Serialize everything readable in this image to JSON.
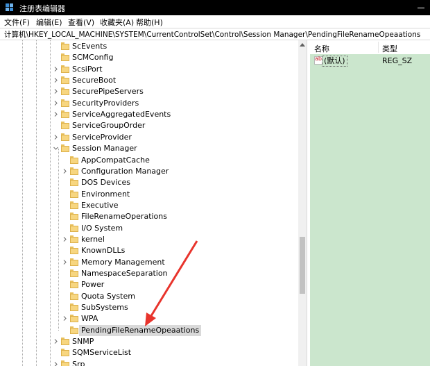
{
  "window": {
    "title": "注册表编辑器"
  },
  "menu": [
    "文件(F)",
    "编辑(E)",
    "查看(V)",
    "收藏夹(A)",
    "帮助(H)"
  ],
  "address": "计算机\\HKEY_LOCAL_MACHINE\\SYSTEM\\CurrentControlSet\\Control\\Session Manager\\PendingFileRenameOpeaations",
  "tree": {
    "items": [
      {
        "label": "ScEvents",
        "depth": 0,
        "expandable": false
      },
      {
        "label": "SCMConfig",
        "depth": 0,
        "expandable": false
      },
      {
        "label": "ScsiPort",
        "depth": 0,
        "expandable": true
      },
      {
        "label": "SecureBoot",
        "depth": 0,
        "expandable": true
      },
      {
        "label": "SecurePipeServers",
        "depth": 0,
        "expandable": true
      },
      {
        "label": "SecurityProviders",
        "depth": 0,
        "expandable": true
      },
      {
        "label": "ServiceAggregatedEvents",
        "depth": 0,
        "expandable": true
      },
      {
        "label": "ServiceGroupOrder",
        "depth": 0,
        "expandable": false
      },
      {
        "label": "ServiceProvider",
        "depth": 0,
        "expandable": true
      },
      {
        "label": "Session Manager",
        "depth": 0,
        "expandable": true,
        "expanded": true
      },
      {
        "label": "AppCompatCache",
        "depth": 1,
        "expandable": false
      },
      {
        "label": "Configuration Manager",
        "depth": 1,
        "expandable": true
      },
      {
        "label": "DOS Devices",
        "depth": 1,
        "expandable": false
      },
      {
        "label": "Environment",
        "depth": 1,
        "expandable": false
      },
      {
        "label": "Executive",
        "depth": 1,
        "expandable": false
      },
      {
        "label": "FileRenameOperations",
        "depth": 1,
        "expandable": false
      },
      {
        "label": "I/O System",
        "depth": 1,
        "expandable": false
      },
      {
        "label": "kernel",
        "depth": 1,
        "expandable": true
      },
      {
        "label": "KnownDLLs",
        "depth": 1,
        "expandable": false
      },
      {
        "label": "Memory Management",
        "depth": 1,
        "expandable": true
      },
      {
        "label": "NamespaceSeparation",
        "depth": 1,
        "expandable": false
      },
      {
        "label": "Power",
        "depth": 1,
        "expandable": false
      },
      {
        "label": "Quota System",
        "depth": 1,
        "expandable": false
      },
      {
        "label": "SubSystems",
        "depth": 1,
        "expandable": false
      },
      {
        "label": "WPA",
        "depth": 1,
        "expandable": true
      },
      {
        "label": "PendingFileRenameOpeaations",
        "depth": 1,
        "expandable": false,
        "selected": true
      },
      {
        "label": "SNMP",
        "depth": 0,
        "expandable": true
      },
      {
        "label": "SQMServiceList",
        "depth": 0,
        "expandable": false
      },
      {
        "label": "Srp",
        "depth": 0,
        "expandable": true
      }
    ]
  },
  "values": {
    "headers": {
      "name": "名称",
      "type": "类型"
    },
    "rows": [
      {
        "name": "(默认)",
        "type": "REG_SZ",
        "icon": "string-value-icon"
      }
    ]
  },
  "colors": {
    "titlebar": "#000000",
    "values_background": "#cbe6cd",
    "selection": "#d9d9d9",
    "annotation_arrow": "#e8342c"
  }
}
